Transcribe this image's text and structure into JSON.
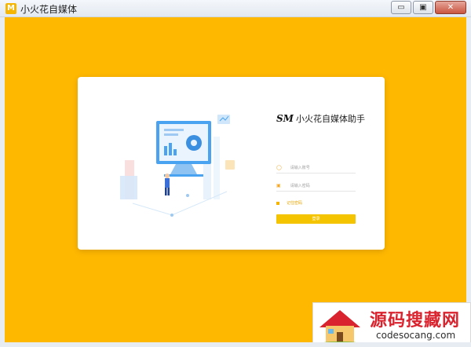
{
  "window": {
    "title": "小火花自媒体",
    "app_icon_glyph": "M",
    "minimize_glyph": "▭",
    "maximize_glyph": "▣",
    "close_glyph": "✕"
  },
  "colors": {
    "accent": "#ffb800",
    "button": "#f5c400",
    "card": "#ffffff"
  },
  "login": {
    "brand_logo": "SM",
    "brand_name": "小火花自媒体助手",
    "account_icon": "user-icon",
    "password_icon": "lock-icon",
    "account_placeholder": "请输入账号",
    "password_placeholder": "请输入密码",
    "remember_label": "记住密码",
    "login_label": "登录"
  },
  "watermark": {
    "title": "源码搜藏网",
    "subtitle": "codesocang.com"
  }
}
